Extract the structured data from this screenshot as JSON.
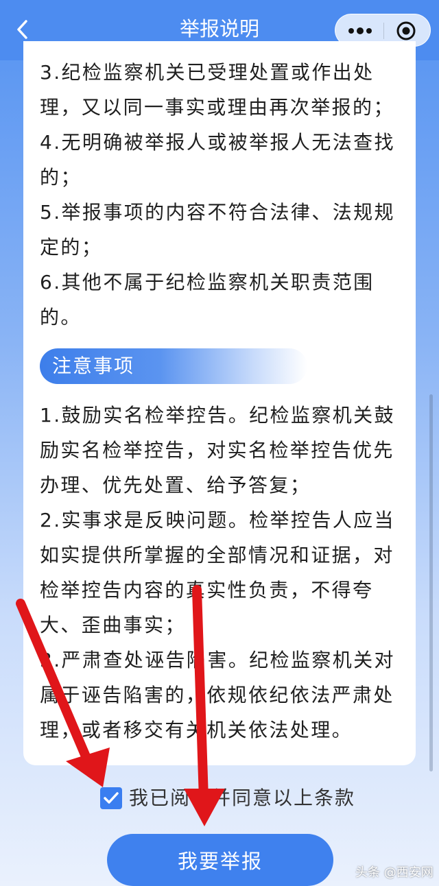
{
  "nav": {
    "title": "举报说明",
    "back_icon": "chevron-left-icon",
    "more_icon": "more-dots-icon",
    "close_icon": "target-circle-icon"
  },
  "content": {
    "list_a": [
      "3.纪检监察机关已受理处置或作出处理，又以同一事实或理由再次举报的；",
      "4.无明确被举报人或被举报人无法查找的；",
      "5.举报事项的内容不符合法律、法规规定的；",
      "6.其他不属于纪检监察机关职责范围的。"
    ],
    "section_title": "注意事项",
    "list_b": [
      "1.鼓励实名检举控告。纪检监察机关鼓励实名检举控告，对实名检举控告优先办理、优先处置、给予答复；",
      "2.实事求是反映问题。检举控告人应当如实提供所掌握的全部情况和证据，对检举控告内容的真实性负责，不得夸大、歪曲事实；",
      "3.严肃查处诬告陷害。纪检监察机关对属于诬告陷害的，依规依纪依法严肃处理，或者移交有关机关依法处理。"
    ]
  },
  "agreement": {
    "checked": true,
    "label": "我已阅读并同意以上条款"
  },
  "submit_label": "我要举报",
  "watermark": "头条 @西安网",
  "colors": {
    "primary": "#3f81ee",
    "nav": "#4d8cf0",
    "annotation_arrow": "#e0161a"
  }
}
